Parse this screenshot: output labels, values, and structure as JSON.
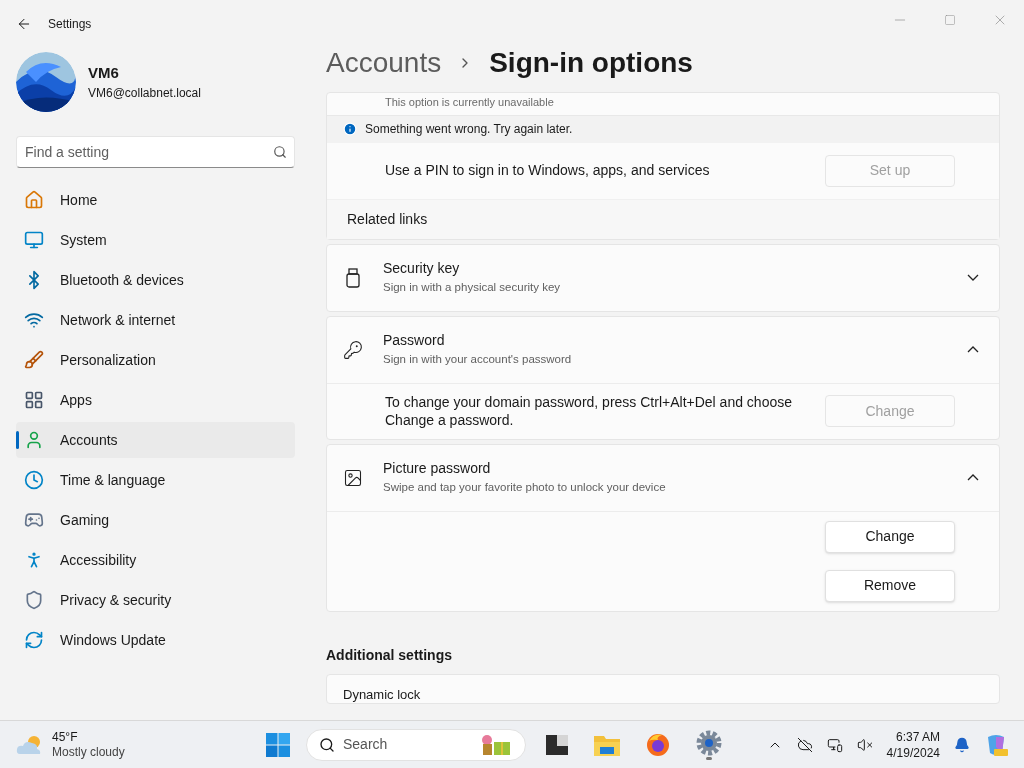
{
  "window": {
    "title": "Settings"
  },
  "user": {
    "name": "VM6",
    "email": "VM6@collabnet.local"
  },
  "search": {
    "placeholder": "Find a setting"
  },
  "nav": [
    {
      "label": "Home",
      "kind": "home",
      "selected": false
    },
    {
      "label": "System",
      "kind": "system",
      "selected": false
    },
    {
      "label": "Bluetooth & devices",
      "kind": "bluetooth",
      "selected": false
    },
    {
      "label": "Network & internet",
      "kind": "network",
      "selected": false
    },
    {
      "label": "Personalization",
      "kind": "brush",
      "selected": false
    },
    {
      "label": "Apps",
      "kind": "apps",
      "selected": false
    },
    {
      "label": "Accounts",
      "kind": "accounts",
      "selected": true
    },
    {
      "label": "Time & language",
      "kind": "time",
      "selected": false
    },
    {
      "label": "Gaming",
      "kind": "gaming",
      "selected": false
    },
    {
      "label": "Accessibility",
      "kind": "accessibility",
      "selected": false
    },
    {
      "label": "Privacy & security",
      "kind": "privacy",
      "selected": false
    },
    {
      "label": "Windows Update",
      "kind": "update",
      "selected": false
    }
  ],
  "breadcrumb": {
    "parent": "Accounts",
    "current": "Sign-in options"
  },
  "pin_section": {
    "note": "This option is currently unavailable",
    "error": "Something went wrong. Try again later.",
    "description": "Use a PIN to sign in to Windows, apps, and services",
    "button": {
      "label": "Set up",
      "disabled": true
    },
    "related": "Related links"
  },
  "options": [
    {
      "kind": "usb",
      "title": "Security key",
      "subtitle": "Sign in with a physical security key",
      "expanded": false
    },
    {
      "kind": "key",
      "title": "Password",
      "subtitle": "Sign in with your account's password",
      "expanded": true,
      "body": {
        "kind": "text_button",
        "text": "To change your domain password, press Ctrl+Alt+Del and choose Change a password.",
        "buttons": [
          {
            "label": "Change",
            "disabled": true
          }
        ]
      }
    },
    {
      "kind": "picture",
      "title": "Picture password",
      "subtitle": "Swipe and tap your favorite photo to unlock your device",
      "expanded": true,
      "body": {
        "kind": "buttons",
        "buttons": [
          {
            "label": "Change",
            "disabled": false
          },
          {
            "label": "Remove",
            "disabled": false
          }
        ]
      }
    }
  ],
  "additional": {
    "heading": "Additional settings",
    "first_item": "Dynamic lock"
  },
  "taskbar": {
    "temperature": "45°F",
    "condition": "Mostly cloudy",
    "search_placeholder": "Search",
    "time": "6:37 AM",
    "date": "4/19/2024"
  }
}
